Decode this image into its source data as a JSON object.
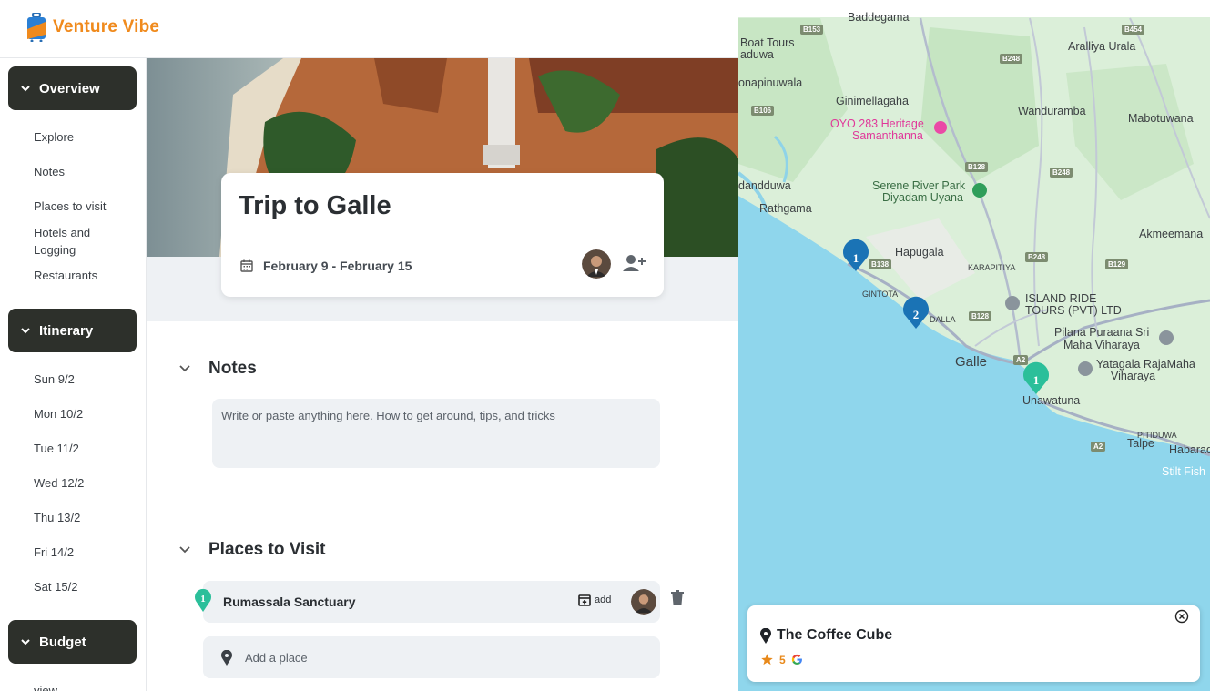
{
  "app": {
    "name": "Venture Vibe",
    "brand_color": "#f08a1c"
  },
  "sidebar": {
    "overview": {
      "label": "Overview",
      "items": [
        "Explore",
        "Notes",
        "Places to visit",
        "Hotels and Logging",
        "Restaurants"
      ]
    },
    "itinerary": {
      "label": "Itinerary",
      "items": [
        "Sun 9/2",
        "Mon 10/2",
        "Tue 11/2",
        "Wed 12/2",
        "Thu 13/2",
        "Fri 14/2",
        "Sat 15/2"
      ]
    },
    "budget": {
      "label": "Budget",
      "items": [
        "view"
      ]
    }
  },
  "trip": {
    "title": "Trip to Galle",
    "dates": "February 9 - February 15"
  },
  "notes": {
    "heading": "Notes",
    "placeholder": "Write or paste anything here. How to get around, tips, and tricks"
  },
  "places": {
    "heading": "Places to Visit",
    "items": [
      {
        "number": "1",
        "name": "Rumassala Sanctuary",
        "add_label": "add"
      }
    ],
    "add_placeholder": "Add a place"
  },
  "map": {
    "labels": {
      "baddegama": "Baddegama",
      "boat_tours": "Boat Tours",
      "aduwa": "aduwa",
      "aralliya": "Aralliya Urala",
      "onapinuwala": "onapinuwala",
      "ginimellagaha": "Ginimellagaha",
      "oyo": "OYO 283 Heritage",
      "samanthanna": "Samanthanna",
      "wanduramba": "Wanduramba",
      "mabotuwana": "Mabotuwana",
      "serene": "Serene River Park",
      "diyadam": "Diyadam Uyana",
      "dandduwa": "dandduwa",
      "rathgama": "Rathgama",
      "hapugala": "Hapugala",
      "akmeemana": "Akmeemana",
      "karapitiya": "KARAPITIYA",
      "gintota": "GINTOTA",
      "island_ride": "ISLAND RIDE",
      "tours_pvt": "TOURS (PVT) LTD",
      "dalla": "DALLA",
      "pilana": "Pilana Puraana Sri",
      "maha_viharaya": "Maha Viharaya",
      "galle": "Galle",
      "yatagala": "Yatagala RajaMaha",
      "viharaya": "Viharaya",
      "unawatuna": "Unawatuna",
      "pitiduwa": "PITIDUWA",
      "talpe": "Talpe",
      "habarad": "Habarad",
      "stilt": "Stilt Fish"
    },
    "roads": [
      "B153",
      "B454",
      "B248",
      "B106",
      "B128",
      "B248",
      "B138",
      "B248",
      "B129",
      "B128",
      "A2",
      "A2"
    ],
    "markers": [
      "1",
      "2",
      "1"
    ],
    "info_card": {
      "title": "The Coffee Cube",
      "rating": "5"
    }
  }
}
